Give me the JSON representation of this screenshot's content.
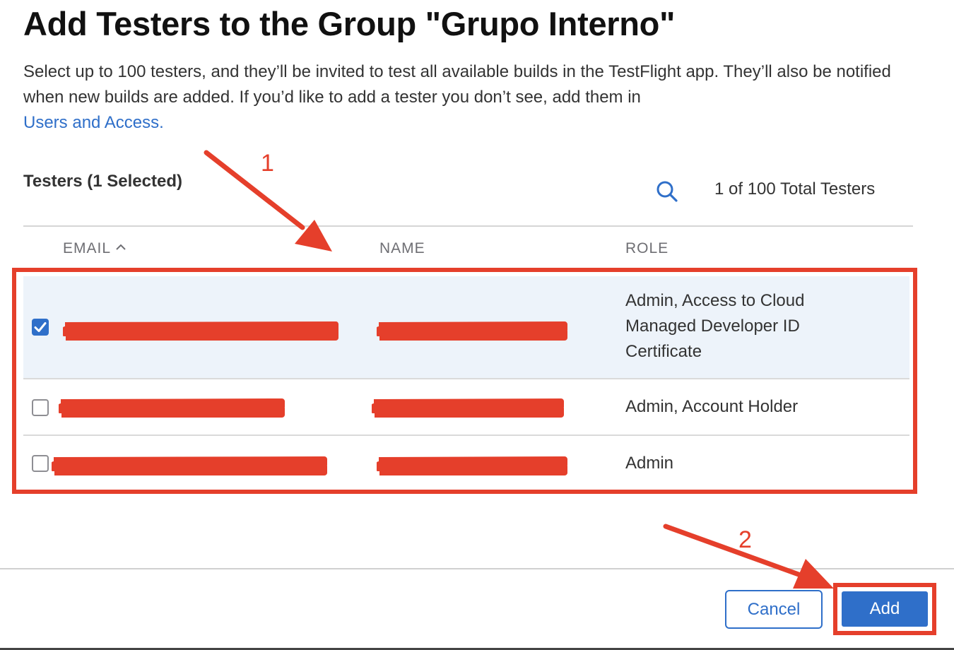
{
  "dialog": {
    "title": "Add Testers to the Group \"Grupo Interno\"",
    "description": "Select up to 100 testers, and they’ll be invited to test all available builds in the TestFlight app. They’ll also be notified when new builds are added. If you’d like to add a tester you don’t see, add them in",
    "link_text": "Users and Access."
  },
  "testers": {
    "section_title": "Testers (1 Selected)",
    "total_count": "1 of 100 Total Testers",
    "columns": {
      "email": "EMAIL",
      "name": "NAME",
      "role": "ROLE"
    },
    "rows": [
      {
        "checked": true,
        "role_lines": [
          "Admin, Access to Cloud",
          "Managed Developer ID",
          "Certificate"
        ]
      },
      {
        "checked": false,
        "role_lines": [
          "Admin, Account Holder"
        ]
      },
      {
        "checked": false,
        "role_lines": [
          "Admin"
        ]
      }
    ]
  },
  "footer": {
    "cancel_label": "Cancel",
    "add_label": "Add"
  },
  "annotations": {
    "step1": "1",
    "step2": "2"
  },
  "colors": {
    "accent": "#2f6fc9",
    "annotation": "#e53f2b",
    "selected_row": "#edf3fa"
  },
  "icons": {
    "search": "search-icon",
    "sort": "chevron-up-icon",
    "check": "checkmark-icon"
  }
}
